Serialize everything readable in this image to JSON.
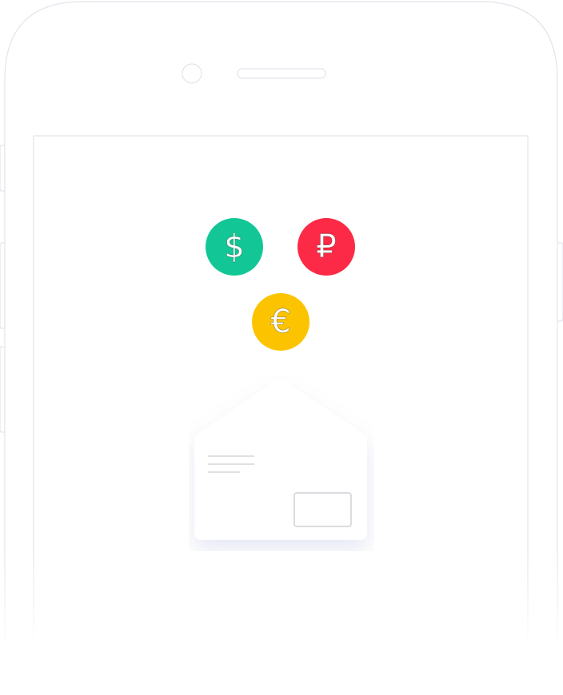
{
  "colors": {
    "dollar": "#12c795",
    "ruble": "#fc2a46",
    "euro": "#fcc400",
    "outline": "#e3e4ec"
  },
  "coins": [
    {
      "id": "dollar",
      "symbol": "$"
    },
    {
      "id": "ruble",
      "symbol": "₽"
    },
    {
      "id": "euro",
      "symbol": "€"
    }
  ],
  "icons": {
    "phone": "phone-outline-icon",
    "envelope": "envelope-icon"
  }
}
